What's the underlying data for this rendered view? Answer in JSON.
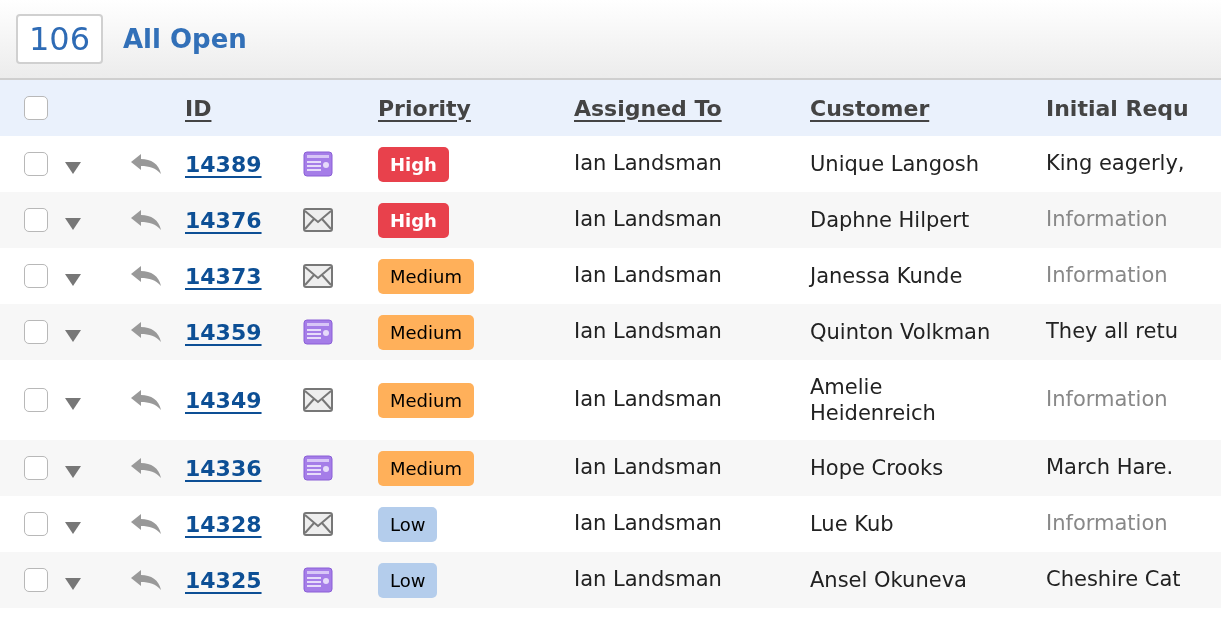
{
  "header": {
    "count": "106",
    "title": "All Open"
  },
  "table": {
    "select_all": {
      "checked": false
    },
    "columns": [
      {
        "label": "ID",
        "sortable": true
      },
      {
        "label": "Priority",
        "sortable": true
      },
      {
        "label": "Assigned To",
        "sortable": true
      },
      {
        "label": "Customer",
        "sortable": true
      },
      {
        "label": "Initial Requ",
        "sortable": false
      }
    ],
    "rows": [
      {
        "checked": false,
        "id": "14389",
        "channel": {
          "kind": "chat"
        },
        "priority": {
          "kind": "high",
          "label": "High"
        },
        "assigned_to": "Ian Landsman",
        "customer": "Unique Langosh",
        "request": {
          "text": "King eagerly,",
          "muted": false
        }
      },
      {
        "checked": false,
        "id": "14376",
        "channel": {
          "kind": "email"
        },
        "priority": {
          "kind": "high",
          "label": "High"
        },
        "assigned_to": "Ian Landsman",
        "customer": "Daphne Hilpert",
        "request": {
          "text": "Information",
          "muted": true
        }
      },
      {
        "checked": false,
        "id": "14373",
        "channel": {
          "kind": "email"
        },
        "priority": {
          "kind": "medium",
          "label": "Medium"
        },
        "assigned_to": "Ian Landsman",
        "customer": "Janessa Kunde",
        "request": {
          "text": "Information",
          "muted": true
        }
      },
      {
        "checked": false,
        "id": "14359",
        "channel": {
          "kind": "chat"
        },
        "priority": {
          "kind": "medium",
          "label": "Medium"
        },
        "assigned_to": "Ian Landsman",
        "customer": "Quinton Volkman",
        "request": {
          "text": "They all retu",
          "muted": false
        }
      },
      {
        "checked": false,
        "id": "14349",
        "channel": {
          "kind": "email"
        },
        "priority": {
          "kind": "medium",
          "label": "Medium"
        },
        "assigned_to": "Ian Landsman",
        "customer": "Amelie Heidenreich",
        "request": {
          "text": "Information",
          "muted": true
        }
      },
      {
        "checked": false,
        "id": "14336",
        "channel": {
          "kind": "chat"
        },
        "priority": {
          "kind": "medium",
          "label": "Medium"
        },
        "assigned_to": "Ian Landsman",
        "customer": "Hope Crooks",
        "request": {
          "text": "March Hare.",
          "muted": false
        }
      },
      {
        "checked": false,
        "id": "14328",
        "channel": {
          "kind": "email"
        },
        "priority": {
          "kind": "low",
          "label": "Low"
        },
        "assigned_to": "Ian Landsman",
        "customer": "Lue Kub",
        "request": {
          "text": "Information",
          "muted": true
        }
      },
      {
        "checked": false,
        "id": "14325",
        "channel": {
          "kind": "chat"
        },
        "priority": {
          "kind": "low",
          "label": "Low"
        },
        "assigned_to": "Ian Landsman",
        "customer": "Ansel Okuneva",
        "request": {
          "text": "Cheshire Cat",
          "muted": false
        }
      }
    ]
  }
}
